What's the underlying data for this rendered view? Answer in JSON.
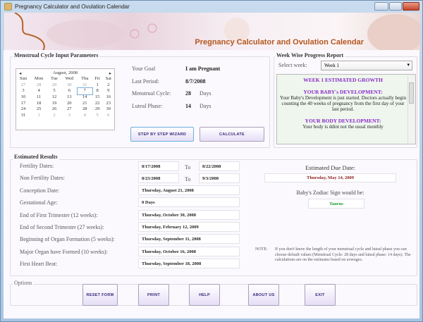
{
  "window": {
    "title": "Pregnancy Calculator and Ovulation Calendar"
  },
  "banner": {
    "title": "Pregnancy Calculator and Ovulation Calendar"
  },
  "input_group": {
    "label": "Menstrual Cycle Input Parameters",
    "calendar": {
      "month_label": "August, 2008",
      "weekdays": [
        "Sun",
        "Mon",
        "Tue",
        "Wed",
        "Thu",
        "Fri",
        "Sat"
      ],
      "weeks": [
        [
          "27",
          "28",
          "29",
          "30",
          "31",
          "1",
          "2"
        ],
        [
          "3",
          "4",
          "5",
          "6",
          "7",
          "8",
          "9"
        ],
        [
          "10",
          "11",
          "12",
          "13",
          "14",
          "15",
          "16"
        ],
        [
          "17",
          "18",
          "19",
          "20",
          "21",
          "22",
          "23"
        ],
        [
          "24",
          "25",
          "26",
          "27",
          "28",
          "29",
          "30"
        ],
        [
          "31",
          "1",
          "2",
          "3",
          "4",
          "5",
          "6"
        ]
      ],
      "selected": "7"
    },
    "fields": [
      {
        "label": "Your Goal",
        "value": "I am Pregnant",
        "unit": ""
      },
      {
        "label": "Last Period:",
        "value": "8/7/2008",
        "unit": ""
      },
      {
        "label": "Menstrual Cycle:",
        "value": "28",
        "unit": "Days"
      },
      {
        "label": "Luteal Phase:",
        "value": "14",
        "unit": "Days"
      }
    ],
    "wizard_button": "Step by Step Wizard",
    "calculate_button": "Calculate"
  },
  "week_group": {
    "label": "Week Wise Progress Report",
    "select_label": "Select week:",
    "select_value": "Week 1",
    "report": {
      "heading": "WEEK 1 ESTIMATED GROWTH",
      "baby_heading": "YOUR BABY's DEVELOPMENT:",
      "baby_text": "Your Baby's Development is just started. Doctors actually begin counting the 40 weeks of pregnancy from the first day of your last period.",
      "body_heading": "YOUR BODY DEVELOPMENT:",
      "body_text": "Your body is ddint not the usual monthly"
    }
  },
  "results": {
    "label": "Estimated Results",
    "to_label": "To",
    "fertility": {
      "label": "Fertility Dates:",
      "from": "8/17/2008",
      "to": "8/22/2008"
    },
    "non_fertility": {
      "label": "Non Fertility Dates:",
      "from": "8/23/2008",
      "to": "9/3/2008"
    },
    "rows": [
      {
        "label": "Conception Date:",
        "value": "Thursday, August 21, 2008"
      },
      {
        "label": "Gestational Age:",
        "value": "0 Days"
      },
      {
        "label": "End of First Trimester (12 weeks):",
        "value": "Thursday, October 30, 2008"
      },
      {
        "label": "End of Second Trimester (27 weeks):",
        "value": "Thursday, February 12, 2009"
      },
      {
        "label": "Beginning of Organ Formation (5 weeks):",
        "value": "Thursday, September 11, 2008"
      },
      {
        "label": "Major Organ have Formed (10 weeks):",
        "value": "Thursday, October 16, 2008"
      },
      {
        "label": "First Heart Beat:",
        "value": "Thursday, September 18, 2008"
      }
    ],
    "due_date_label": "Estimated Due Date:",
    "due_date": "Thursday, May 14, 2009",
    "zodiac_label": "Baby's Zodiac Sign would be:",
    "zodiac": "Taurus",
    "note_label": "NOTE:",
    "note_text": "If you don't know the length of your menstrual cycle and luteal phase you can choose default values (Menstrual Cycle: 28 days and luteal phase: 14 days). The calculations are on the estimates based on averages."
  },
  "options": {
    "label": "Options",
    "buttons": [
      "Reset Form",
      "Print",
      "Help",
      "About us",
      "Exit"
    ]
  },
  "colors": {
    "due_date": "#8b1a1a",
    "zodiac": "#1a9a2a",
    "report_heading": "#8a2ac8",
    "button_text": "#3a2a7a"
  }
}
